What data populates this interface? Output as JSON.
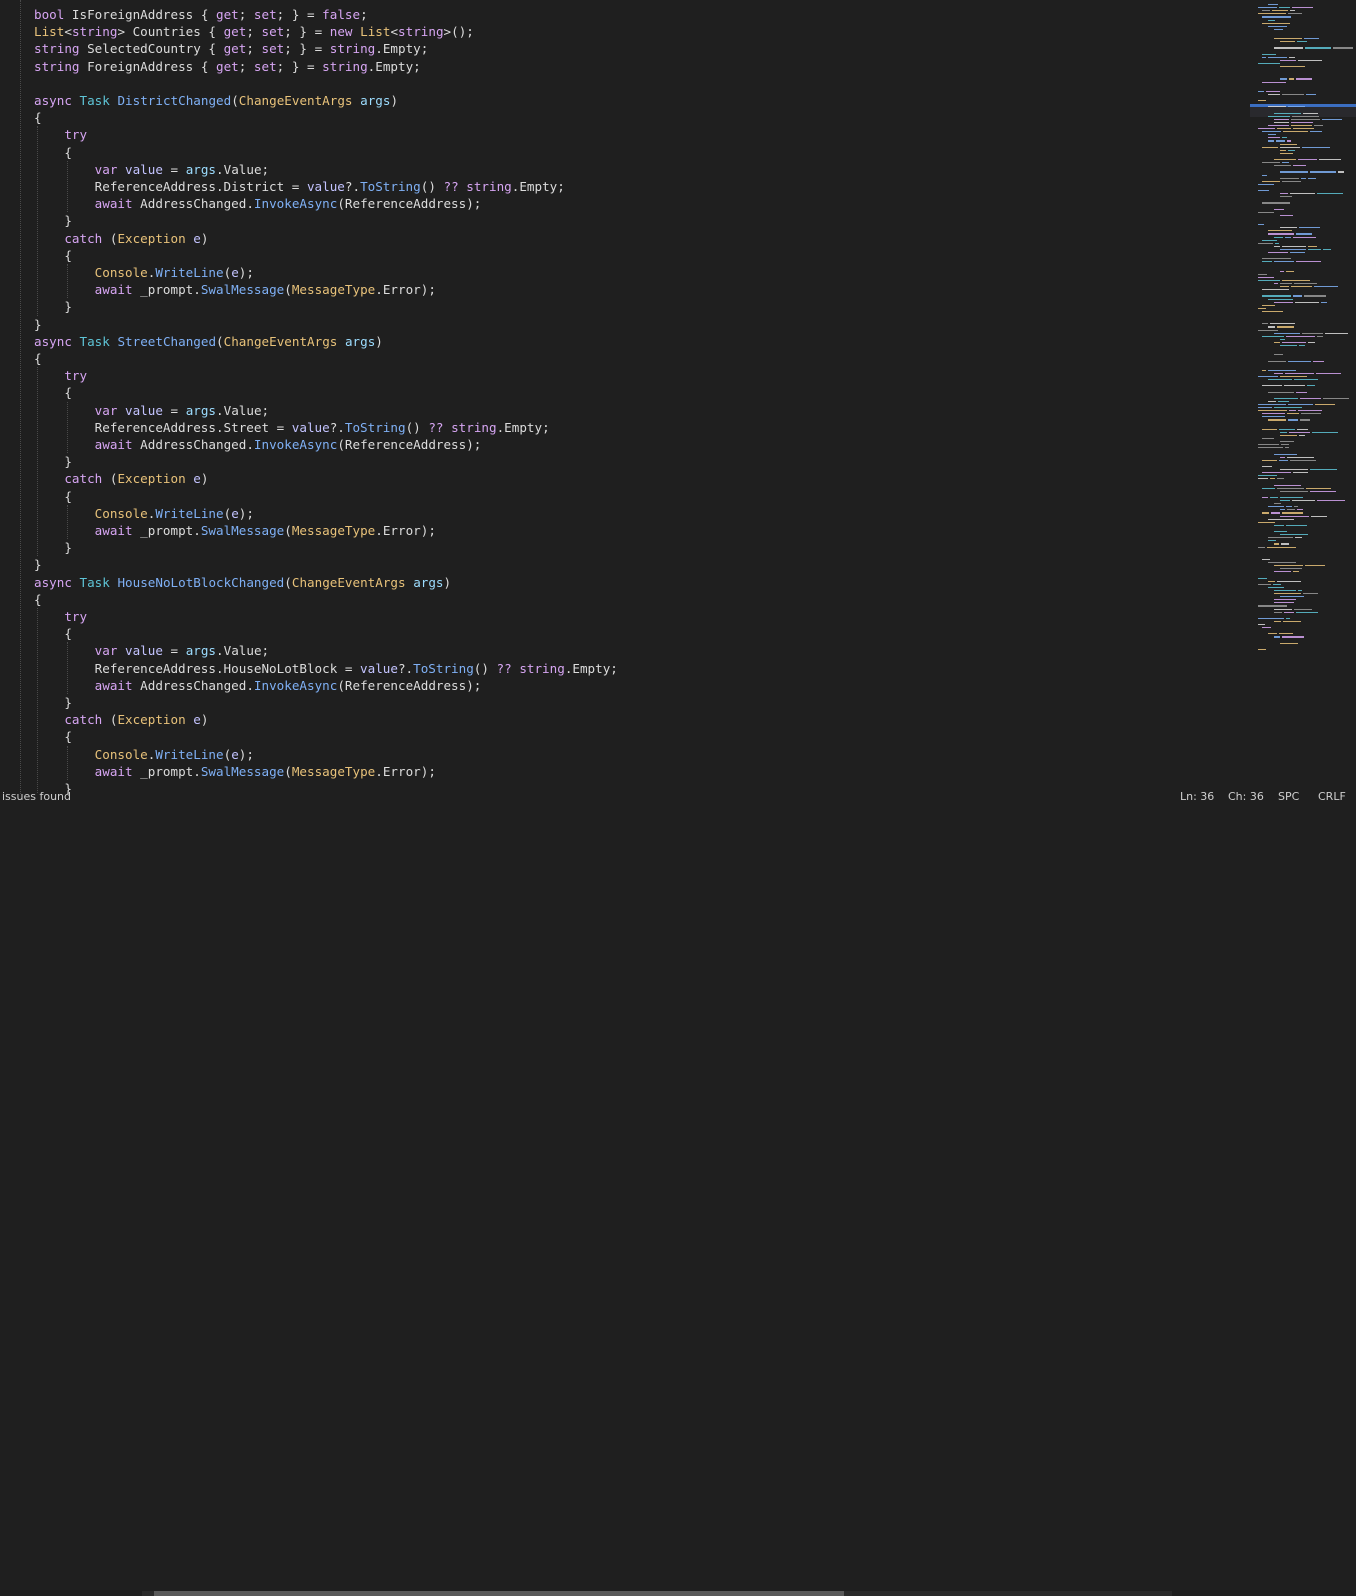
{
  "code": {
    "lines": [
      [
        [
          "kw",
          "bool"
        ],
        [
          "pl",
          " IsForeignAddress { "
        ],
        [
          "kw",
          "get"
        ],
        [
          "pl",
          "; "
        ],
        [
          "kw",
          "set"
        ],
        [
          "pl",
          "; } = "
        ],
        [
          "kw",
          "false"
        ],
        [
          "pl",
          ";"
        ]
      ],
      [
        [
          "type",
          "List"
        ],
        [
          "pl",
          "<"
        ],
        [
          "kw",
          "string"
        ],
        [
          "pl",
          "> Countries { "
        ],
        [
          "kw",
          "get"
        ],
        [
          "pl",
          "; "
        ],
        [
          "kw",
          "set"
        ],
        [
          "pl",
          "; } = "
        ],
        [
          "kw",
          "new"
        ],
        [
          "pl",
          " "
        ],
        [
          "type",
          "List"
        ],
        [
          "pl",
          "<"
        ],
        [
          "kw",
          "string"
        ],
        [
          "pl",
          ">();"
        ]
      ],
      [
        [
          "kw",
          "string"
        ],
        [
          "pl",
          " SelectedCountry { "
        ],
        [
          "kw",
          "get"
        ],
        [
          "pl",
          "; "
        ],
        [
          "kw",
          "set"
        ],
        [
          "pl",
          "; } = "
        ],
        [
          "kw",
          "string"
        ],
        [
          "pl",
          ".Empty;"
        ]
      ],
      [
        [
          "kw",
          "string"
        ],
        [
          "pl",
          " ForeignAddress { "
        ],
        [
          "kw",
          "get"
        ],
        [
          "pl",
          "; "
        ],
        [
          "kw",
          "set"
        ],
        [
          "pl",
          "; } = "
        ],
        [
          "kw",
          "string"
        ],
        [
          "pl",
          ".Empty;"
        ]
      ],
      [],
      [
        [
          "kw",
          "async"
        ],
        [
          "pl",
          " "
        ],
        [
          "cls",
          "Task"
        ],
        [
          "pl",
          " "
        ],
        [
          "fn",
          "DistrictChanged"
        ],
        [
          "pl",
          "("
        ],
        [
          "type",
          "ChangeEventArgs"
        ],
        [
          "pl",
          " "
        ],
        [
          "prm",
          "args"
        ],
        [
          "pl",
          ")"
        ]
      ],
      [
        [
          "pl",
          "{"
        ]
      ],
      [
        [
          "pl",
          "    "
        ],
        [
          "kw",
          "try"
        ]
      ],
      [
        [
          "pl",
          "    {"
        ]
      ],
      [
        [
          "pl",
          "        "
        ],
        [
          "kw",
          "var"
        ],
        [
          "pl",
          " "
        ],
        [
          "vl",
          "value"
        ],
        [
          "pl",
          " = "
        ],
        [
          "prm",
          "args"
        ],
        [
          "pl",
          ".Value;"
        ]
      ],
      [
        [
          "pl",
          "        ReferenceAddress.District = "
        ],
        [
          "vl",
          "value"
        ],
        [
          "pl",
          "?."
        ],
        [
          "fn",
          "ToString"
        ],
        [
          "pl",
          "() "
        ],
        [
          "kw",
          "??"
        ],
        [
          "pl",
          " "
        ],
        [
          "kw",
          "string"
        ],
        [
          "pl",
          ".Empty;"
        ]
      ],
      [
        [
          "pl",
          "        "
        ],
        [
          "kw",
          "await"
        ],
        [
          "pl",
          " AddressChanged."
        ],
        [
          "fn",
          "InvokeAsync"
        ],
        [
          "pl",
          "(ReferenceAddress);"
        ]
      ],
      [
        [
          "pl",
          "    }"
        ]
      ],
      [
        [
          "pl",
          "    "
        ],
        [
          "kw",
          "catch"
        ],
        [
          "pl",
          " ("
        ],
        [
          "type",
          "Exception"
        ],
        [
          "pl",
          " "
        ],
        [
          "vl",
          "e"
        ],
        [
          "pl",
          ")"
        ]
      ],
      [
        [
          "pl",
          "    {"
        ]
      ],
      [
        [
          "pl",
          "        "
        ],
        [
          "type",
          "Console"
        ],
        [
          "pl",
          "."
        ],
        [
          "fn",
          "WriteLine"
        ],
        [
          "pl",
          "("
        ],
        [
          "vl",
          "e"
        ],
        [
          "pl",
          ");"
        ]
      ],
      [
        [
          "pl",
          "        "
        ],
        [
          "kw",
          "await"
        ],
        [
          "pl",
          " _prompt."
        ],
        [
          "fn",
          "SwalMessage"
        ],
        [
          "pl",
          "("
        ],
        [
          "type",
          "MessageType"
        ],
        [
          "pl",
          ".Error);"
        ]
      ],
      [
        [
          "pl",
          "    }"
        ]
      ],
      [
        [
          "pl",
          "}"
        ]
      ],
      [
        [
          "kw",
          "async"
        ],
        [
          "pl",
          " "
        ],
        [
          "cls",
          "Task"
        ],
        [
          "pl",
          " "
        ],
        [
          "fn",
          "StreetChanged"
        ],
        [
          "pl",
          "("
        ],
        [
          "type",
          "ChangeEventArgs"
        ],
        [
          "pl",
          " "
        ],
        [
          "prm",
          "args"
        ],
        [
          "pl",
          ")"
        ]
      ],
      [
        [
          "pl",
          "{"
        ]
      ],
      [
        [
          "pl",
          "    "
        ],
        [
          "kw",
          "try"
        ]
      ],
      [
        [
          "pl",
          "    {"
        ]
      ],
      [
        [
          "pl",
          "        "
        ],
        [
          "kw",
          "var"
        ],
        [
          "pl",
          " "
        ],
        [
          "vl",
          "value"
        ],
        [
          "pl",
          " = "
        ],
        [
          "prm",
          "args"
        ],
        [
          "pl",
          ".Value;"
        ]
      ],
      [
        [
          "pl",
          "        ReferenceAddress.Street = "
        ],
        [
          "vl",
          "value"
        ],
        [
          "pl",
          "?."
        ],
        [
          "fn",
          "ToString"
        ],
        [
          "pl",
          "() "
        ],
        [
          "kw",
          "??"
        ],
        [
          "pl",
          " "
        ],
        [
          "kw",
          "string"
        ],
        [
          "pl",
          ".Empty;"
        ]
      ],
      [
        [
          "pl",
          "        "
        ],
        [
          "kw",
          "await"
        ],
        [
          "pl",
          " AddressChanged."
        ],
        [
          "fn",
          "InvokeAsync"
        ],
        [
          "pl",
          "(ReferenceAddress);"
        ]
      ],
      [
        [
          "pl",
          "    }"
        ]
      ],
      [
        [
          "pl",
          "    "
        ],
        [
          "kw",
          "catch"
        ],
        [
          "pl",
          " ("
        ],
        [
          "type",
          "Exception"
        ],
        [
          "pl",
          " "
        ],
        [
          "vl",
          "e"
        ],
        [
          "pl",
          ")"
        ]
      ],
      [
        [
          "pl",
          "    {"
        ]
      ],
      [
        [
          "pl",
          "        "
        ],
        [
          "type",
          "Console"
        ],
        [
          "pl",
          "."
        ],
        [
          "fn",
          "WriteLine"
        ],
        [
          "pl",
          "("
        ],
        [
          "vl",
          "e"
        ],
        [
          "pl",
          ");"
        ]
      ],
      [
        [
          "pl",
          "        "
        ],
        [
          "kw",
          "await"
        ],
        [
          "pl",
          " _prompt."
        ],
        [
          "fn",
          "SwalMessage"
        ],
        [
          "pl",
          "("
        ],
        [
          "type",
          "MessageType"
        ],
        [
          "pl",
          ".Error);"
        ]
      ],
      [
        [
          "pl",
          "    }"
        ]
      ],
      [
        [
          "pl",
          "}"
        ]
      ],
      [
        [
          "kw",
          "async"
        ],
        [
          "pl",
          " "
        ],
        [
          "cls",
          "Task"
        ],
        [
          "pl",
          " "
        ],
        [
          "fn",
          "HouseNoLotBlockChanged"
        ],
        [
          "pl",
          "("
        ],
        [
          "type",
          "ChangeEventArgs"
        ],
        [
          "pl",
          " "
        ],
        [
          "prm",
          "args"
        ],
        [
          "pl",
          ")"
        ]
      ],
      [
        [
          "pl",
          "{"
        ]
      ],
      [
        [
          "pl",
          "    "
        ],
        [
          "kw",
          "try"
        ]
      ],
      [
        [
          "pl",
          "    {"
        ]
      ],
      [
        [
          "pl",
          "        "
        ],
        [
          "kw",
          "var"
        ],
        [
          "pl",
          " "
        ],
        [
          "vl",
          "value"
        ],
        [
          "pl",
          " = "
        ],
        [
          "prm",
          "args"
        ],
        [
          "pl",
          ".Value;"
        ]
      ],
      [
        [
          "pl",
          "        ReferenceAddress.HouseNoLotBlock = "
        ],
        [
          "vl",
          "value"
        ],
        [
          "pl",
          "?."
        ],
        [
          "fn",
          "ToString"
        ],
        [
          "pl",
          "() "
        ],
        [
          "kw",
          "??"
        ],
        [
          "pl",
          " "
        ],
        [
          "kw",
          "string"
        ],
        [
          "pl",
          ".Empty;"
        ]
      ],
      [
        [
          "pl",
          "        "
        ],
        [
          "kw",
          "await"
        ],
        [
          "pl",
          " AddressChanged."
        ],
        [
          "fn",
          "InvokeAsync"
        ],
        [
          "pl",
          "(ReferenceAddress);"
        ]
      ],
      [
        [
          "pl",
          "    }"
        ]
      ],
      [
        [
          "pl",
          "    "
        ],
        [
          "kw",
          "catch"
        ],
        [
          "pl",
          " ("
        ],
        [
          "type",
          "Exception"
        ],
        [
          "pl",
          " "
        ],
        [
          "vl",
          "e"
        ],
        [
          "pl",
          ")"
        ]
      ],
      [
        [
          "pl",
          "    {"
        ]
      ],
      [
        [
          "pl",
          "        "
        ],
        [
          "type",
          "Console"
        ],
        [
          "pl",
          "."
        ],
        [
          "fn",
          "WriteLine"
        ],
        [
          "pl",
          "("
        ],
        [
          "vl",
          "e"
        ],
        [
          "pl",
          ");"
        ]
      ],
      [
        [
          "pl",
          "        "
        ],
        [
          "kw",
          "await"
        ],
        [
          "pl",
          " _prompt."
        ],
        [
          "fn",
          "SwalMessage"
        ],
        [
          "pl",
          "("
        ],
        [
          "type",
          "MessageType"
        ],
        [
          "pl",
          ".Error);"
        ]
      ],
      [
        [
          "pl",
          "    }"
        ]
      ]
    ]
  },
  "statusbar": {
    "issues": "issues found",
    "ln": "Ln: 36",
    "ch": "Ch: 36",
    "spc": "SPC",
    "eol": "CRLF"
  },
  "colors": {
    "background": "#1f1f1f",
    "keyword": "#d6a5f2",
    "type": "#e8c27a",
    "class": "#5ec4d6",
    "method": "#7fb0f5",
    "parameter": "#9cdcfe",
    "local": "#c3c3ff",
    "plain": "#dcdcdc"
  }
}
